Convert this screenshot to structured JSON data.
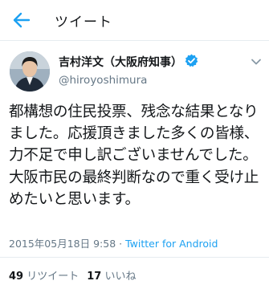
{
  "header": {
    "title": "ツイート",
    "back_icon": "arrow-left-icon"
  },
  "colors": {
    "accent": "#1da1f2",
    "text": "#14171a",
    "secondary": "#657786"
  },
  "tweet": {
    "display_name": "吉村洋文（大阪府知事）",
    "verified_icon": "verified-badge-icon",
    "handle": "@hiroyoshimura",
    "text": "都構想の住民投票、残念な結果となりました。応援頂きました多くの皆様、力不足で申し訳ございませんでした。大阪市民の最終判断なので重く受け止めたいと思います。",
    "timestamp": "2015年05月18日 9:58",
    "separator": " · ",
    "source": "Twitter for Android"
  },
  "stats": {
    "retweets_count": "49",
    "retweets_label": " リツイート",
    "likes_count": "17",
    "likes_label": " いいね"
  }
}
